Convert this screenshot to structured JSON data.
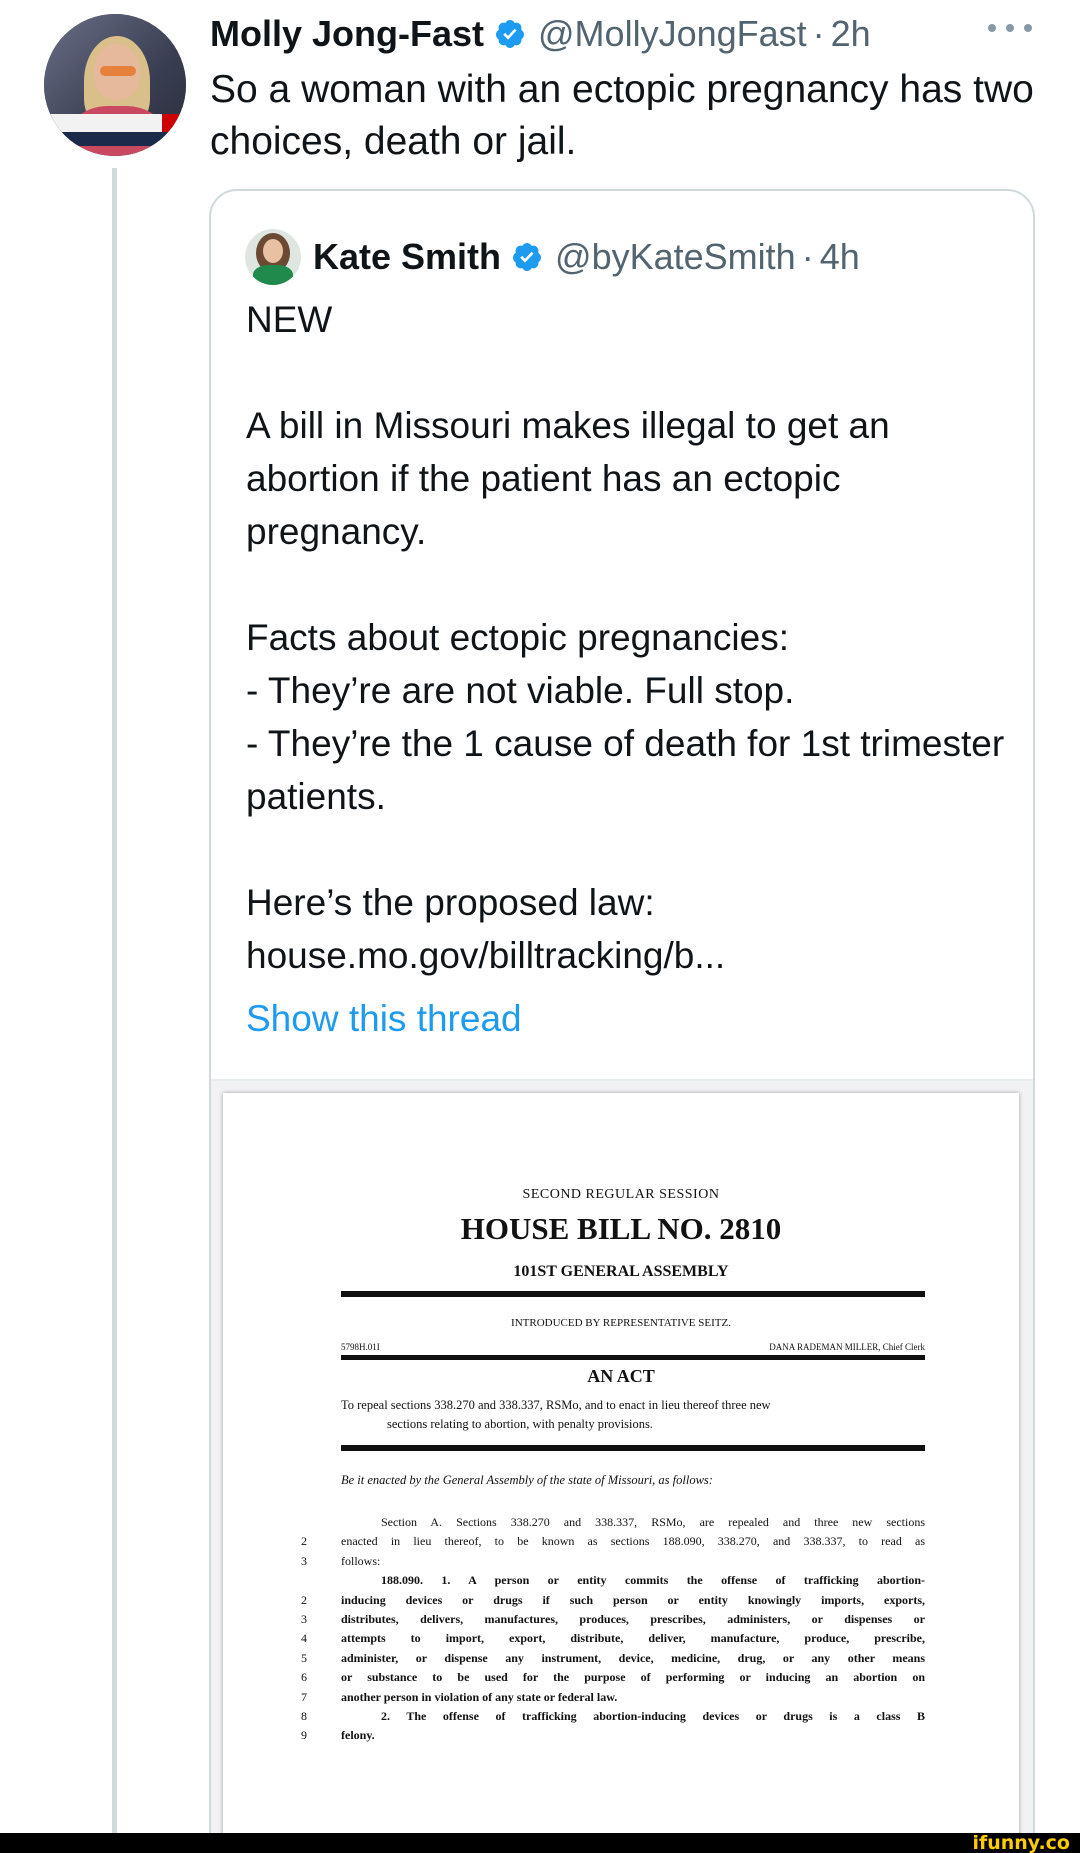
{
  "tweet": {
    "author_name": "Molly Jong-Fast",
    "author_handle": "@MollyJongFast",
    "separator": "·",
    "time": "2h",
    "text": "So a woman with an ectopic pregnancy has two choices, death or jail."
  },
  "quoted_tweet": {
    "author_name": "Kate Smith",
    "author_handle": "@byKateSmith",
    "separator": "·",
    "time": "4h",
    "paragraphs": [
      "NEW",
      "",
      "A bill in Missouri makes illegal to get an abortion if the patient has an ectopic pregnancy.",
      "",
      "Facts about ectopic pregnancies:",
      "- They’re are not viable. Full stop.",
      "- They’re the 1 cause of death for 1st trimester patients.",
      "",
      "Here’s the proposed law:"
    ],
    "link": "house.mo.gov/billtracking/b...",
    "show_thread": "Show this thread"
  },
  "document": {
    "session": "SECOND REGULAR SESSION",
    "title": "HOUSE BILL NO. 2810",
    "assembly": "101ST GENERAL ASSEMBLY",
    "introduced": "INTRODUCED BY REPRESENTATIVE SEITZ.",
    "bill_code": "5798H.01I",
    "clerk": "DANA RADEMAN MILLER, Chief Clerk",
    "act_heading": "AN ACT",
    "purpose_1": "To repeal sections 338.270 and 338.337, RSMo, and to enact in lieu thereof three new",
    "purpose_2": "sections relating to abortion, with penalty provisions.",
    "enacting_clause": "Be it enacted by the General Assembly of the state of Missouri, as follows:",
    "lines": [
      {
        "num": "",
        "text": "Section A.  Sections 338.270 and 338.337, RSMo, are repealed and three new sections",
        "bold": false,
        "indent": true
      },
      {
        "num": "2",
        "text": "enacted in lieu thereof, to be known as sections 188.090, 338.270, and 338.337, to read as",
        "bold": false,
        "indent": false
      },
      {
        "num": "3",
        "text": "follows:",
        "bold": false,
        "indent": false,
        "last": true
      },
      {
        "num": "",
        "text": "188.090.  1.  A person or entity commits the offense of trafficking abortion-",
        "bold": true,
        "indent": true
      },
      {
        "num": "2",
        "text": "inducing devices or drugs if such person or entity knowingly imports, exports,",
        "bold": true,
        "indent": false
      },
      {
        "num": "3",
        "text": "distributes, delivers, manufactures, produces, prescribes, administers, or dispenses or",
        "bold": true,
        "indent": false
      },
      {
        "num": "4",
        "text": "attempts to import, export, distribute, deliver, manufacture, produce, prescribe,",
        "bold": true,
        "indent": false
      },
      {
        "num": "5",
        "text": "administer, or dispense any instrument, device, medicine, drug, or any other means",
        "bold": true,
        "indent": false
      },
      {
        "num": "6",
        "text": "or substance to be used for the purpose of performing or inducing an abortion on",
        "bold": true,
        "indent": false
      },
      {
        "num": "7",
        "text": "another person in violation of any state or federal law.",
        "bold": true,
        "indent": false,
        "last": true
      },
      {
        "num": "8",
        "text": "2.  The offense of trafficking abortion-inducing devices or drugs is a class B",
        "bold": true,
        "indent": true
      },
      {
        "num": "9",
        "text": "felony.",
        "bold": true,
        "indent": false,
        "last": true
      }
    ]
  },
  "watermark": "ifunny.co",
  "colors": {
    "link_blue": "#1d9bf0",
    "verified_blue": "#1d9bf0",
    "secondary_text": "#536471",
    "thread_line": "#cfd9de",
    "watermark_yellow": "#ffcc00"
  },
  "icons": [
    "verified-badge-icon",
    "more-options-icon"
  ]
}
